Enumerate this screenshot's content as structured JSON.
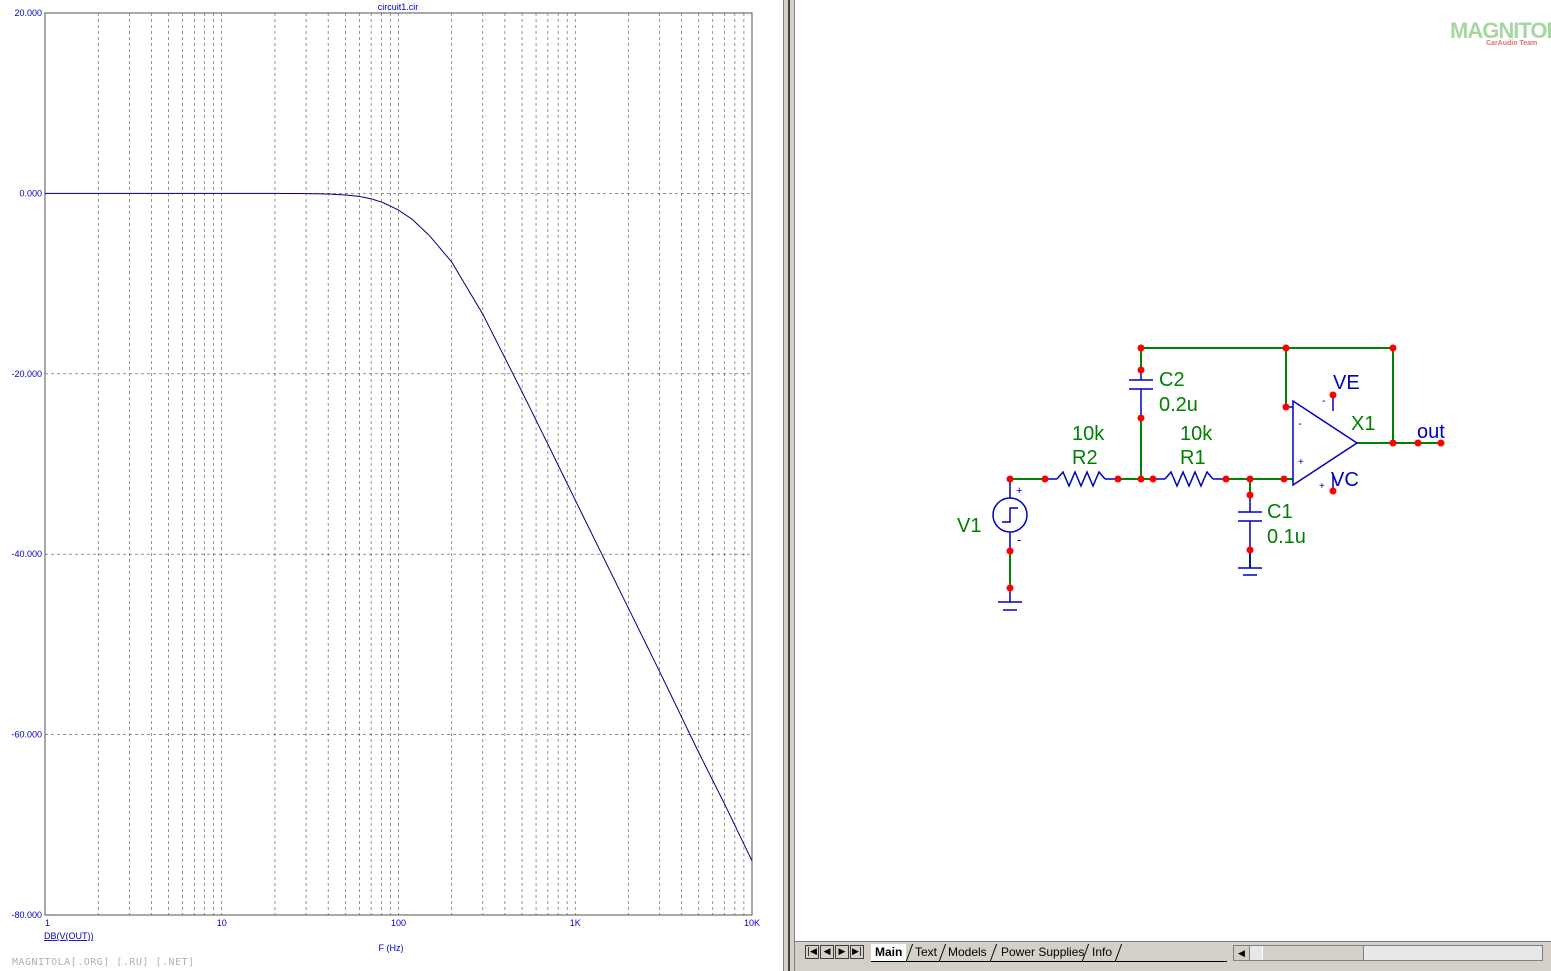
{
  "plot": {
    "title": "circuit1.cir",
    "xlabel": "F (Hz)",
    "trace_label": "DB(V(OUT))",
    "x_ticks": [
      "1",
      "10",
      "100",
      "1K",
      "10K"
    ],
    "y_ticks": [
      "20.000",
      "0.000",
      "-20.000",
      "-40.000",
      "-60.000",
      "-80.000"
    ],
    "colors": {
      "trace": "#000080",
      "grid": "#505050",
      "text": "#0000c0"
    }
  },
  "chart_data": {
    "type": "line",
    "title": "circuit1.cir",
    "xlabel": "F (Hz)",
    "ylabel": "",
    "xscale": "log",
    "xlim": [
      1,
      10000
    ],
    "ylim": [
      -80,
      20
    ],
    "grid": true,
    "series": [
      {
        "name": "DB(V(OUT))",
        "x": [
          1,
          10,
          20,
          30,
          40,
          50,
          60,
          70,
          80,
          90,
          100,
          120,
          150,
          200,
          300,
          500,
          700,
          1000,
          2000,
          3000,
          5000,
          7000,
          10000
        ],
        "y": [
          0,
          0,
          0,
          -0.02,
          -0.07,
          -0.17,
          -0.33,
          -0.6,
          -0.95,
          -1.4,
          -1.85,
          -2.9,
          -4.7,
          -7.6,
          -13.4,
          -22,
          -27.8,
          -34,
          -46,
          -53,
          -62,
          -67.7,
          -74
        ]
      }
    ]
  },
  "schematic": {
    "labels": {
      "v1": "V1",
      "r2_value": "10k",
      "r2_name": "R2",
      "r1_value": "10k",
      "r1_name": "R1",
      "c2_name": "C2",
      "c2_value": "0.2u",
      "c1_name": "C1",
      "c1_value": "0.1u",
      "x1": "X1",
      "ve": "VE",
      "vc": "VC",
      "out": "out",
      "plus": "+",
      "minus": "-"
    },
    "colors": {
      "wire": "#008000",
      "component": "#0000c0",
      "node": "#ff0000",
      "label": "#008000"
    }
  },
  "tabs": {
    "items": [
      "Main",
      "Text",
      "Models",
      "Power Supplies",
      "Info"
    ],
    "active": "Main"
  },
  "watermark": "MAGNITOLA[.ORG] [.RU] [.NET]",
  "logo": {
    "main": "MAGNITOLA",
    "sub": "CarAudio Team"
  }
}
